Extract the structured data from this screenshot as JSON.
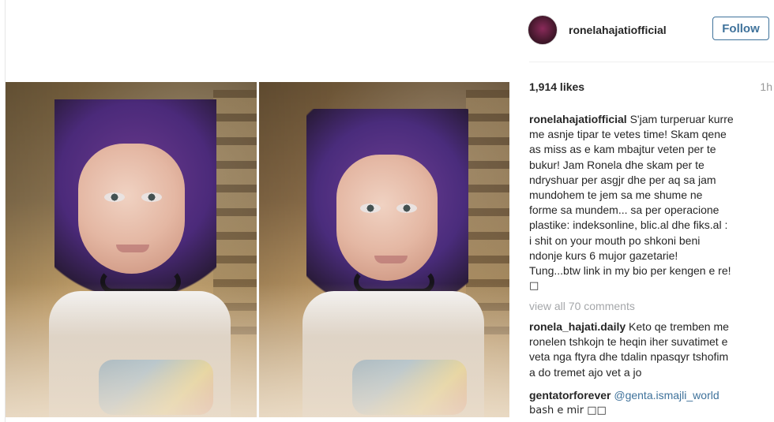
{
  "post": {
    "header": {
      "username": "ronelahajatiofficial",
      "follow_label": "Follow"
    },
    "meta": {
      "likes": "1,914 likes",
      "time": "1h"
    },
    "caption": {
      "username": "ronelahajatiofficial",
      "lines": [
        " S'jam turperuar kurre",
        "me asnje tipar te vetes time! Skam qene",
        "as miss as e kam mbajtur veten per te",
        "bukur! Jam Ronela dhe skam per te",
        "ndryshuar per asgjr dhe per aq sa jam",
        "mundohem te jem sa me shume ne",
        "forme sa mundem... sa per operacione",
        "plastike: indeksonline, blic.al dhe fiks.al :",
        "i shit on your mouth po shkoni beni",
        "ndonje kurs 6 mujor gazetarie!",
        "Tung...btw link in my bio per kengen e re!",
        "□"
      ]
    },
    "comments": {
      "view_all_label": "view all 70 comments",
      "items": [
        {
          "username": "ronela_hajati.daily",
          "lines": [
            " Keto qe tremben me",
            "ronelen tshkojn te heqin iher suvatimet e",
            "veta nga ftyra dhe tdalin npasqyr tshofim",
            "a do tremet ajo vet a jo"
          ]
        },
        {
          "username": "gentatorforever",
          "mention": " @genta.ismajli_world",
          "lines": [
            "bash e mir □□"
          ]
        }
      ]
    }
  },
  "icons": {
    "avatar": "profile-photo",
    "photo_left": "selfie-photo",
    "photo_right": "selfie-photo"
  },
  "colors": {
    "follow_blue": "#3f729b",
    "muted_gray": "#a5a7aa",
    "divider": "#efefef"
  }
}
